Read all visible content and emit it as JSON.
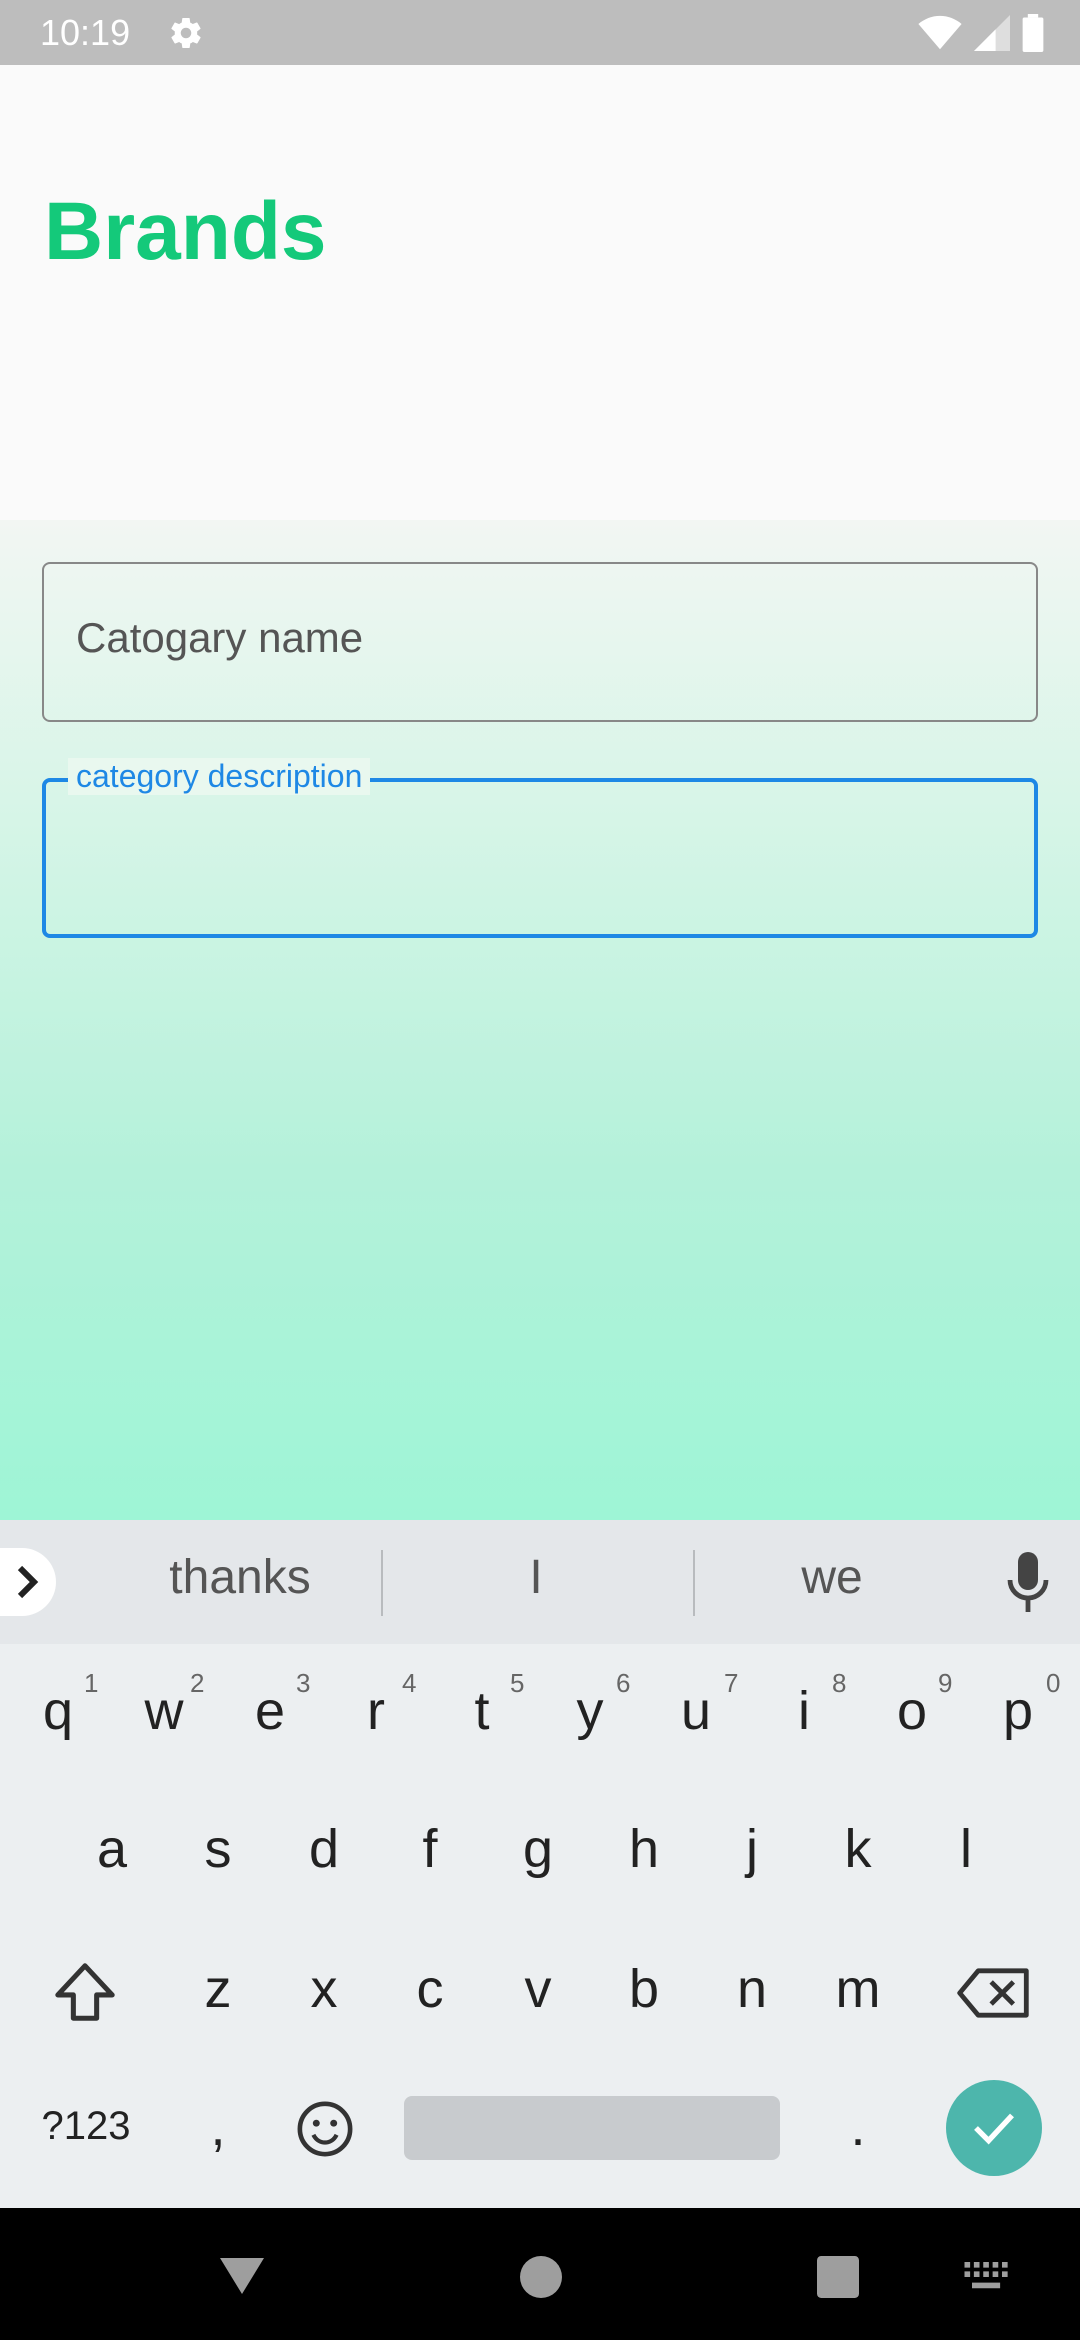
{
  "status_bar": {
    "time": "10:19",
    "icons": [
      "gear-icon",
      "wifi-icon",
      "signal-icon",
      "battery-icon"
    ]
  },
  "header": {
    "title": "Brands",
    "title_color": "#14c97a"
  },
  "form": {
    "name_field": {
      "placeholder": "Catogary name",
      "value": ""
    },
    "description_field": {
      "label": "category description",
      "value": "",
      "focused": true,
      "accent_color": "#1e88e5"
    }
  },
  "keyboard": {
    "suggestions": [
      "thanks",
      "I",
      "we"
    ],
    "row1": [
      "q",
      "w",
      "e",
      "r",
      "t",
      "y",
      "u",
      "i",
      "o",
      "p"
    ],
    "row1_hints": [
      "1",
      "2",
      "3",
      "4",
      "5",
      "6",
      "7",
      "8",
      "9",
      "0"
    ],
    "row2": [
      "a",
      "s",
      "d",
      "f",
      "g",
      "h",
      "j",
      "k",
      "l"
    ],
    "row3": [
      "z",
      "x",
      "c",
      "v",
      "b",
      "n",
      "m"
    ],
    "symbols_label": "?123",
    "comma": ",",
    "period": "."
  },
  "nav_bar": {
    "buttons": [
      "back-icon",
      "home-icon",
      "recents-icon",
      "keyboard-switch-icon"
    ]
  }
}
